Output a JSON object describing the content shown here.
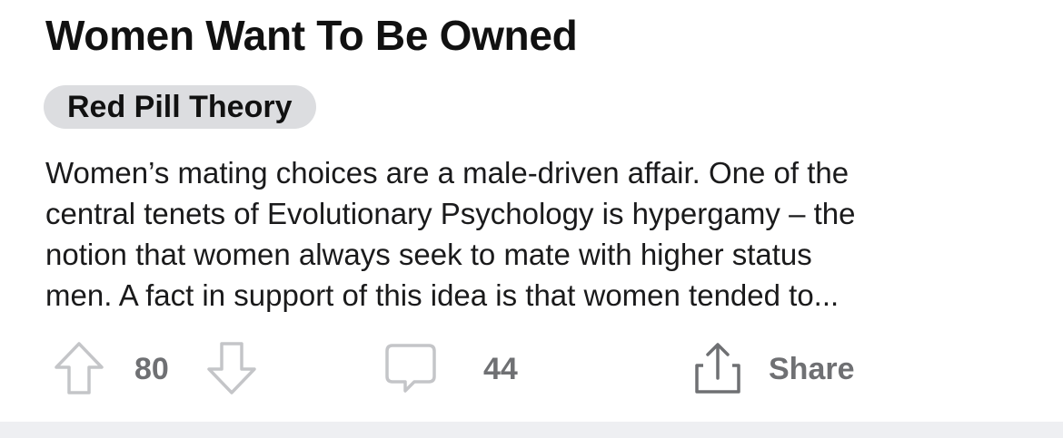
{
  "post": {
    "title": "Women Want To Be Owned",
    "flair": "Red Pill Theory",
    "body_lines": [
      "Women’s mating choices are a male-driven affair. One of the",
      "central tenets of Evolutionary Psychology is hypergamy – the",
      "notion that women always seek to mate with higher status",
      "men. A fact in support of this idea is that women tended to..."
    ]
  },
  "actions": {
    "upvote_icon": "arrow-up-icon",
    "vote_count": "80",
    "downvote_icon": "arrow-down-icon",
    "comment_icon": "speech-bubble-icon",
    "comment_count": "44",
    "share_icon": "share-upload-icon",
    "share_label": "Share"
  },
  "colors": {
    "flair_bg": "#dcdde0",
    "icon_gray": "#c4c5c8",
    "count_gray": "#6f7073",
    "footer_bg": "#eeeff2"
  }
}
